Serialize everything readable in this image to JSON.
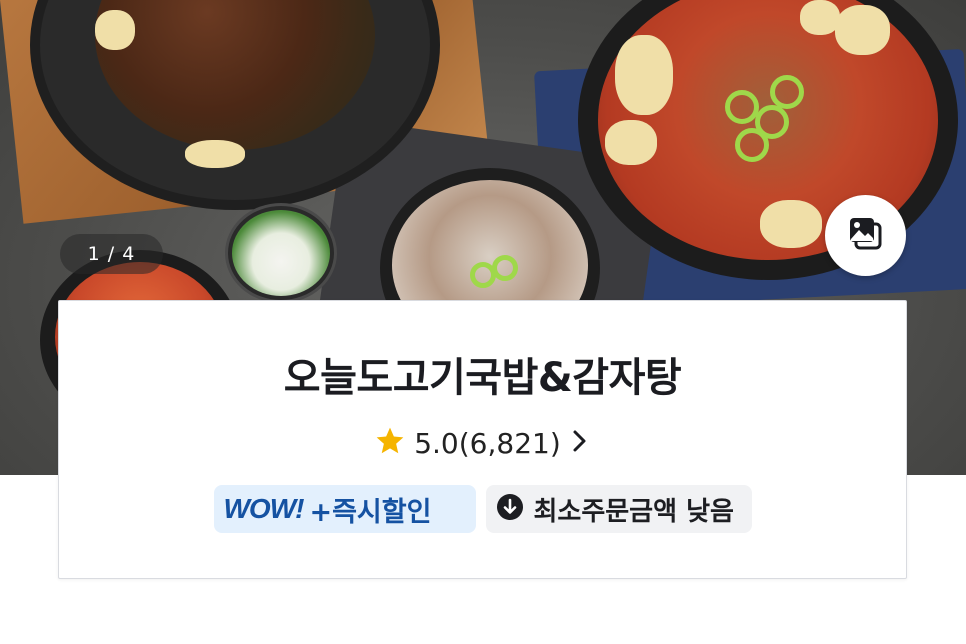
{
  "hero": {
    "counter": "1 / 4",
    "image_alt": "restaurant-food-photo"
  },
  "store": {
    "name": "오늘도고기국밥&감자탕",
    "rating": "5.0",
    "review_count": "(6,821)",
    "rating_display": "5.0(6,821)"
  },
  "badges": {
    "wow_logo": "WOW!",
    "wow_label": "+즉시할인",
    "min_order_label": "최소주문금액 낮음"
  },
  "colors": {
    "star": "#f5b400",
    "wow_blue": "#1552a2",
    "wow_bg": "#e3f0fd"
  },
  "icons": [
    "gallery-icon",
    "star-icon",
    "chevron-right-icon",
    "arrow-down-circle-icon"
  ]
}
